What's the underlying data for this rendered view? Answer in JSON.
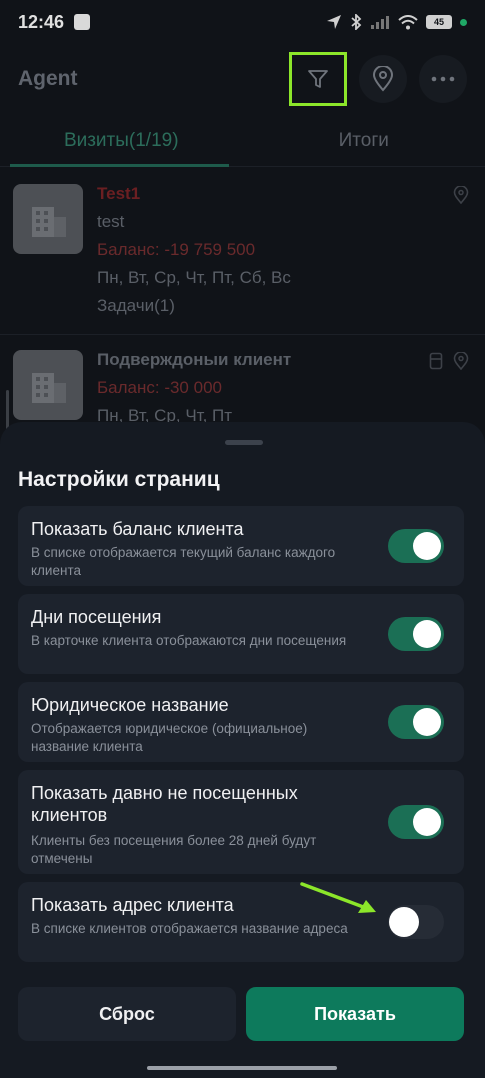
{
  "status_bar": {
    "time": "12:46",
    "battery": "45",
    "colors": {
      "dot": "#1fa866"
    }
  },
  "header": {
    "title": "Agent",
    "icons": [
      "filter-icon",
      "location-pin-icon",
      "more-icon"
    ]
  },
  "tabs": [
    {
      "label": "Визиты(1/19)",
      "active": true
    },
    {
      "label": "Итоги",
      "active": false
    }
  ],
  "clients": [
    {
      "name": "Test1",
      "subtitle": "test",
      "balance": "Баланс: -19 759 500",
      "days": "Пн, Вт, Ср, Чт, Пт, Сб, Вс",
      "tasks": "Задачи(1)"
    },
    {
      "name": "Подверждоныи клиент",
      "balance": "Баланс: -30 000",
      "days": "Пн, Вт, Ср, Чт, Пт"
    }
  ],
  "sheet": {
    "title": "Настройки страниц",
    "settings": [
      {
        "title": "Показать баланс клиента",
        "description": "В списке отображается текущий баланс каждого клиента",
        "enabled": true
      },
      {
        "title": "Дни посещения",
        "description": "В карточке клиента отображаются дни посещения",
        "enabled": true
      },
      {
        "title": "Юридическое название",
        "description": "Отображается юридическое (официальное) название клиента",
        "enabled": true
      },
      {
        "title": "Показать давно не посещенных клиентов",
        "description": "Клиенты без посещения более 28 дней будут отмечены",
        "enabled": true
      },
      {
        "title": "Показать адрес клиента",
        "description": "В списке клиентов отображается название адреса",
        "enabled": false
      }
    ],
    "reset_label": "Сброс",
    "show_label": "Показать"
  },
  "colors": {
    "accent": "#0d7a5c",
    "toggle_on": "#1b6f55",
    "highlight": "#8ce62a",
    "negative_balance": "#6a2a2c"
  }
}
